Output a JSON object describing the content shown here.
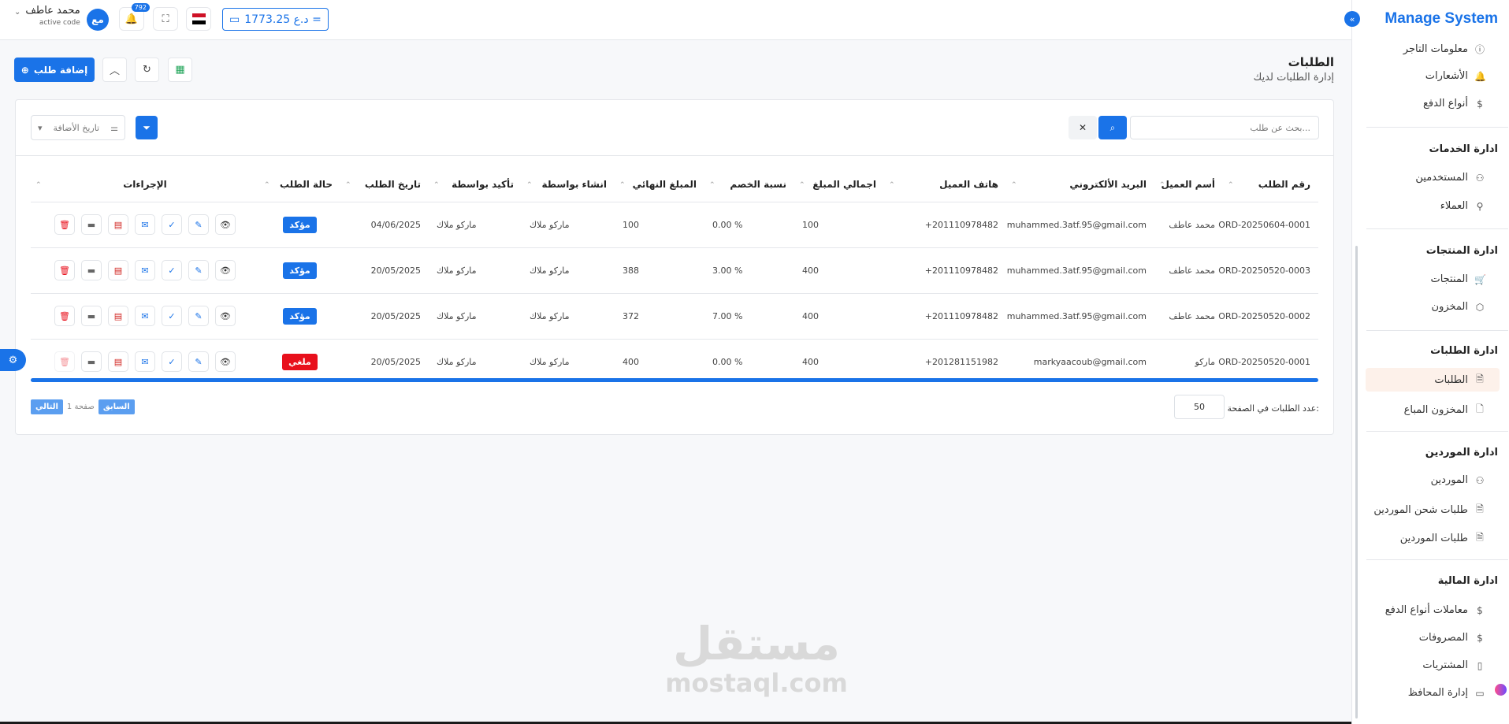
{
  "header": {
    "user_name": "محمد عاطف",
    "user_sub": "active code",
    "avatar_initials": "مع",
    "notifications_count": "792",
    "balance": "1773.25 د.ع ="
  },
  "sidebar": {
    "brand": "Manage System",
    "top_items": [
      {
        "label": "معلومات التاجر",
        "icon": "info-icon"
      },
      {
        "label": "الأشعارات",
        "icon": "bell-icon"
      },
      {
        "label": "أنواع الدفع",
        "icon": "dollar-icon"
      }
    ],
    "sections": [
      {
        "title": "ادارة الخدمات",
        "items": [
          {
            "label": "المستخدمين",
            "icon": "users-icon"
          },
          {
            "label": "العملاء",
            "icon": "user-check-icon"
          }
        ]
      },
      {
        "title": "ادارة المنتجات",
        "items": [
          {
            "label": "المنتجات",
            "icon": "cart-icon"
          },
          {
            "label": "المخزون",
            "icon": "box-icon"
          }
        ]
      },
      {
        "title": "ادارة الطلبات",
        "items": [
          {
            "label": "الطلبات",
            "icon": "file-icon",
            "active": true
          },
          {
            "label": "المخزون المباع",
            "icon": "file-icon"
          }
        ]
      },
      {
        "title": "ادارة الموردين",
        "items": [
          {
            "label": "الموردين",
            "icon": "users-icon"
          },
          {
            "label": "طلبات شحن الموردين",
            "icon": "file-icon"
          },
          {
            "label": "طلبات الموردين",
            "icon": "file-icon"
          }
        ]
      },
      {
        "title": "ادارة المالية",
        "items": [
          {
            "label": "معاملات أنواع الدفع",
            "icon": "dollar-icon"
          },
          {
            "label": "المصروفات",
            "icon": "dollar-icon"
          },
          {
            "label": "المشتريات",
            "icon": "receipt-icon"
          },
          {
            "label": "إدارة المحافظ",
            "icon": "wallet-icon"
          }
        ]
      }
    ]
  },
  "page": {
    "title": "الطلبات",
    "subtitle": "إدارة الطلبات لديك",
    "add_button": "إضافة طلب"
  },
  "filters": {
    "search_placeholder": "بحث عن طلب...",
    "date_label": "تاريخ الأضافة"
  },
  "table": {
    "columns": [
      "رقم الطلب",
      "أسم العميل",
      "البريد الألكتروني",
      "هاتف العميل",
      "اجمالي المبلغ",
      "نسبة الخصم",
      "المبلغ النهائي",
      "انشاء بواسطة",
      "تأكيد بواسطة",
      "تاريخ الطلب",
      "حالة الطلب",
      "الإجراءات"
    ],
    "rows": [
      {
        "order_no": "ORD-20250604-0001",
        "customer": "محمد عاطف",
        "email": "muhammed.3atf.95@gmail.com",
        "phone": "201110978482+",
        "total": "100",
        "discount": "% 0.00",
        "final": "100",
        "created_by": "ماركو ملاك",
        "confirmed_by": "ماركو ملاك",
        "date": "04/06/2025",
        "status": "مؤكد",
        "status_color": "#1a73e8"
      },
      {
        "order_no": "ORD-20250520-0003",
        "customer": "محمد عاطف",
        "email": "muhammed.3atf.95@gmail.com",
        "phone": "201110978482+",
        "total": "400",
        "discount": "% 3.00",
        "final": "388",
        "created_by": "ماركو ملاك",
        "confirmed_by": "ماركو ملاك",
        "date": "20/05/2025",
        "status": "مؤكد",
        "status_color": "#1a73e8"
      },
      {
        "order_no": "ORD-20250520-0002",
        "customer": "محمد عاطف",
        "email": "muhammed.3atf.95@gmail.com",
        "phone": "201110978482+",
        "total": "400",
        "discount": "% 7.00",
        "final": "372",
        "created_by": "ماركو ملاك",
        "confirmed_by": "ماركو ملاك",
        "date": "20/05/2025",
        "status": "مؤكد",
        "status_color": "#1a73e8"
      },
      {
        "order_no": "ORD-20250520-0001",
        "customer": "ماركو",
        "email": "markyaacoub@gmail.com",
        "phone": "201281151982+",
        "total": "400",
        "discount": "% 0.00",
        "final": "400",
        "created_by": "ماركو ملاك",
        "confirmed_by": "ماركو ملاك",
        "date": "20/05/2025",
        "status": "ملغي",
        "status_color": "#e8101c"
      }
    ],
    "actions": [
      {
        "name": "view-icon",
        "glyph": "👁",
        "color": "#333"
      },
      {
        "name": "edit-icon",
        "glyph": "✎",
        "color": "#1a73e8"
      },
      {
        "name": "confirm-icon",
        "glyph": "✓",
        "color": "#1a73e8"
      },
      {
        "name": "mail-icon",
        "glyph": "✉",
        "color": "#1a73e8"
      },
      {
        "name": "pdf-icon",
        "glyph": "▤",
        "color": "#d0201c"
      },
      {
        "name": "wallet-icon",
        "glyph": "▬",
        "color": "#666"
      },
      {
        "name": "delete-icon",
        "glyph": "🗑",
        "color": "#e8101c"
      }
    ]
  },
  "pagination": {
    "per_page_label": "عدد الطلبات في الصفحة:",
    "per_page_value": "50",
    "prev": "السابق",
    "page_info": "صفحة 1",
    "next": "التالي"
  },
  "watermark": {
    "arabic": "مستقل",
    "latin": "mostaql.com"
  },
  "colors": {
    "primary": "#1a73e8",
    "danger": "#e8101c",
    "active_bg": "#fdf1ea"
  }
}
